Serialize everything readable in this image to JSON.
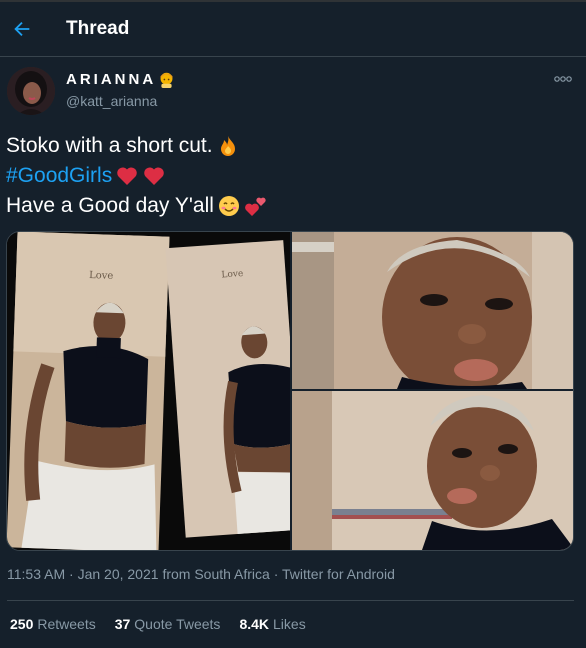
{
  "header": {
    "title": "Thread",
    "back_icon": "arrow-left-icon"
  },
  "author": {
    "display_name": "ARIANNA",
    "name_emoji": "person-emoji",
    "handle": "@katt_arianna"
  },
  "tweet": {
    "line1": "Stoko with a short cut.",
    "line1_emoji": "fire-emoji",
    "hashtag": "#GoodGirls",
    "hashtag_emojis": [
      "red-heart-emoji",
      "red-heart-emoji"
    ],
    "line3": "Have a Good day Y'all",
    "line3_emojis": [
      "smiling-face-emoji",
      "two-hearts-emoji"
    ]
  },
  "media": {
    "photo_captions": [
      "Love",
      "Love"
    ],
    "photo_count": 3
  },
  "meta": {
    "time": "11:53 AM",
    "date": "Jan 20, 2021",
    "location": "from South Africa",
    "source": "Twitter for Android",
    "separator": "·"
  },
  "stats": {
    "retweets_count": "250",
    "retweets_label": "Retweets",
    "quotes_count": "37",
    "quotes_label": "Quote Tweets",
    "likes_count": "8.4K",
    "likes_label": "Likes"
  },
  "colors": {
    "background": "#15202b",
    "accent": "#1da1f2",
    "muted": "#8899a6",
    "border": "#38444d"
  }
}
